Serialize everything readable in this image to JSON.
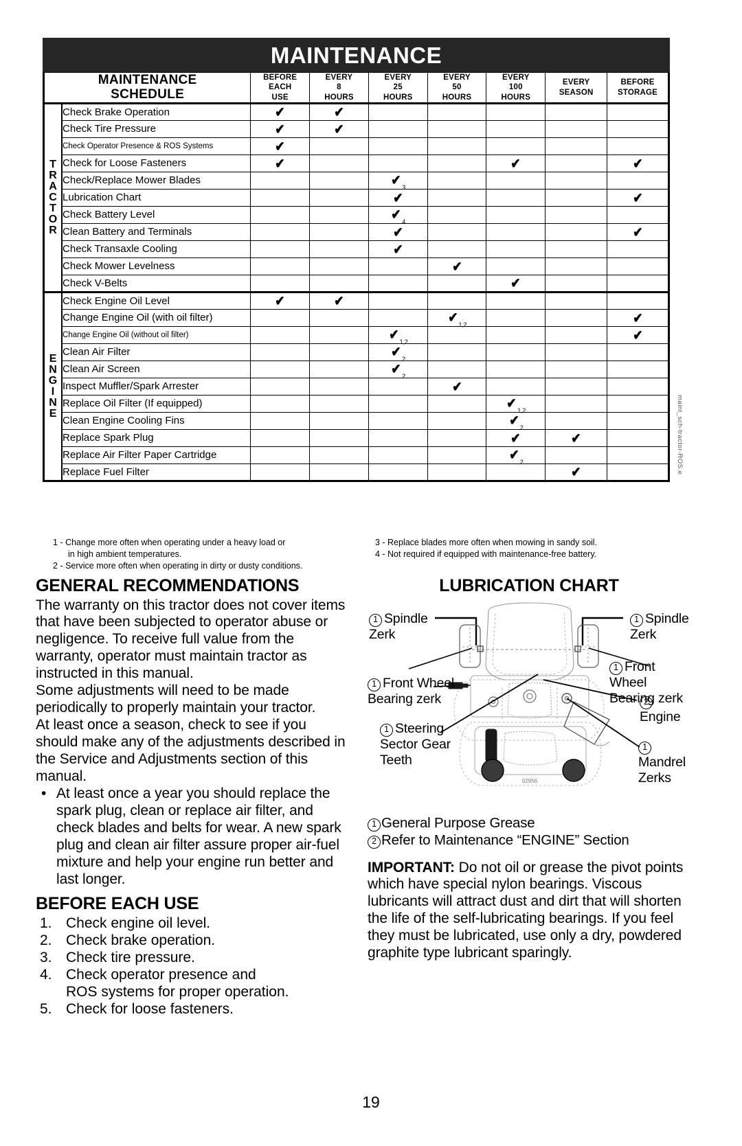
{
  "banner": {
    "title": "MAINTENANCE"
  },
  "schedule": {
    "title_line1": "MAINTENANCE",
    "title_line2": "SCHEDULE",
    "columns": [
      {
        "line1": "BEFORE",
        "line2": "EACH",
        "line3": "USE"
      },
      {
        "line1": "EVERY",
        "line2": "8",
        "line3": "HOURS"
      },
      {
        "line1": "EVERY",
        "line2": "25",
        "line3": "HOURS"
      },
      {
        "line1": "EVERY",
        "line2": "50",
        "line3": "HOURS"
      },
      {
        "line1": "EVERY",
        "line2": "100",
        "line3": "HOURS"
      },
      {
        "line1": "EVERY",
        "line2": "SEASON",
        "line3": ""
      },
      {
        "line1": "BEFORE",
        "line2": "STORAGE",
        "line3": ""
      }
    ],
    "groups": [
      {
        "name": "TRACTOR",
        "letters": [
          "T",
          "R",
          "A",
          "C",
          "T",
          "O",
          "R"
        ],
        "rows": [
          {
            "task": "Check Brake Operation",
            "small": false,
            "marks": [
              "x",
              "x",
              "",
              "",
              "",
              "",
              ""
            ]
          },
          {
            "task": "Check Tire Pressure",
            "small": false,
            "marks": [
              "x",
              "x",
              "",
              "",
              "",
              "",
              ""
            ]
          },
          {
            "task": "Check Operator Presence & ROS Systems",
            "small": true,
            "marks": [
              "x",
              "",
              "",
              "",
              "",
              "",
              ""
            ]
          },
          {
            "task": "Check for Loose Fasteners",
            "small": false,
            "marks": [
              "x",
              "",
              "",
              "",
              "x",
              "",
              "x"
            ]
          },
          {
            "task": "Check/Replace Mower Blades",
            "small": false,
            "marks": [
              "",
              "",
              "x:3",
              "",
              "",
              "",
              ""
            ]
          },
          {
            "task": "Lubrication Chart",
            "small": false,
            "marks": [
              "",
              "",
              "x",
              "",
              "",
              "",
              "x"
            ]
          },
          {
            "task": "Check Battery Level",
            "small": false,
            "marks": [
              "",
              "",
              "x:4",
              "",
              "",
              "",
              ""
            ]
          },
          {
            "task": "Clean Battery and Terminals",
            "small": false,
            "marks": [
              "",
              "",
              "x",
              "",
              "",
              "",
              "x"
            ]
          },
          {
            "task": "Check Transaxle Cooling",
            "small": false,
            "marks": [
              "",
              "",
              "x",
              "",
              "",
              "",
              ""
            ]
          },
          {
            "task": "Check Mower Levelness",
            "small": false,
            "marks": [
              "",
              "",
              "",
              "x",
              "",
              "",
              ""
            ]
          },
          {
            "task": "Check V-Belts",
            "small": false,
            "marks": [
              "",
              "",
              "",
              "",
              "x",
              "",
              ""
            ]
          }
        ]
      },
      {
        "name": "ENGINE",
        "letters": [
          "E",
          "N",
          "G",
          "I",
          "N",
          "E"
        ],
        "rows": [
          {
            "task": "Check Engine Oil Level",
            "small": false,
            "marks": [
              "x",
              "x",
              "",
              "",
              "",
              "",
              ""
            ]
          },
          {
            "task": "Change Engine Oil (with oil filter)",
            "small": false,
            "marks": [
              "",
              "",
              "",
              "x:1,2",
              "",
              "",
              "x"
            ]
          },
          {
            "task": "Change Engine Oil (without oil filter)",
            "small": true,
            "marks": [
              "",
              "",
              "x:1,2",
              "",
              "",
              "",
              "x"
            ]
          },
          {
            "task": "Clean Air Filter",
            "small": false,
            "marks": [
              "",
              "",
              "x:2",
              "",
              "",
              "",
              ""
            ]
          },
          {
            "task": "Clean Air Screen",
            "small": false,
            "marks": [
              "",
              "",
              "x:2",
              "",
              "",
              "",
              ""
            ]
          },
          {
            "task": "Inspect Muffler/Spark Arrester",
            "small": false,
            "marks": [
              "",
              "",
              "",
              "x",
              "",
              "",
              ""
            ]
          },
          {
            "task": "Replace Oil Filter (If equipped)",
            "small": false,
            "marks": [
              "",
              "",
              "",
              "",
              "x:1,2",
              "",
              ""
            ]
          },
          {
            "task": "Clean Engine Cooling Fins",
            "small": false,
            "marks": [
              "",
              "",
              "",
              "",
              "x:2",
              "",
              ""
            ]
          },
          {
            "task": "Replace Spark Plug",
            "small": false,
            "marks": [
              "",
              "",
              "",
              "",
              "x",
              "x",
              ""
            ]
          },
          {
            "task": "Replace Air Filter Paper Cartridge",
            "small": false,
            "marks": [
              "",
              "",
              "",
              "",
              "x:2",
              "",
              ""
            ]
          },
          {
            "task": "Replace Fuel Filter",
            "small": false,
            "marks": [
              "",
              "",
              "",
              "",
              "",
              "x",
              ""
            ]
          }
        ]
      }
    ],
    "footnotes_left": [
      {
        "num": "1 - ",
        "line1": "Change more often when operating under a heavy load or",
        "line2": "in high ambient temperatures."
      },
      {
        "num": "2 - ",
        "line1": "Service more often when operating in dirty or dusty conditions.",
        "line2": ""
      }
    ],
    "footnotes_right": [
      {
        "num": "3 - ",
        "line1": "Replace blades more often when mowing in sandy soil.",
        "line2": ""
      },
      {
        "num": "4 - ",
        "line1": "Not required if equipped with maintenance-free battery.",
        "line2": ""
      }
    ]
  },
  "general": {
    "heading": "GENERAL RECOMMENDATIONS",
    "para1": "The warranty on this tractor does not cover items that have been subjected to operator abuse or negligence.  To receive full value from the warranty, operator must maintain tractor as instructed in this manual.",
    "para2": "Some adjustments will need to be made periodically to properly maintain your tractor.",
    "para3": "At least once a season, check to see if you should make any of the adjustments described in the Service and Adjustments section of this manual.",
    "bullet_dot": "•",
    "bullet1": "At least once a year you should replace the spark plug, clean or replace air filter, and check blades and belts for wear. A new spark plug and clean air filter assure proper air-fuel mixture and help your engine run better and last longer."
  },
  "before_each_use": {
    "heading": "BEFORE EACH USE",
    "items": [
      {
        "num": "1.",
        "text": "Check engine oil level."
      },
      {
        "num": "2.",
        "text": "Check brake operation."
      },
      {
        "num": "3.",
        "text": "Check tire pressure."
      },
      {
        "num": "4.",
        "text": "Check operator presence and"
      },
      {
        "num": "5.",
        "text": "Check for loose fasteners."
      }
    ],
    "item4_cont": "ROS systems for proper operation."
  },
  "lubrication": {
    "heading": "LUBRICATION CHART",
    "labels": {
      "spindle_left_l1": "Spindle",
      "spindle_left_l2": "Zerk",
      "spindle_right_l1": "Spindle",
      "spindle_right_l2": "Zerk",
      "front_wheel_left_l1": "Front Wheel",
      "front_wheel_left_l2": "Bearing zerk",
      "front_wheel_right_l1": "Front Wheel",
      "front_wheel_right_l2": "Bearing zerk",
      "engine": "Engine",
      "steering_l1": "Steering",
      "steering_l2": "Sector Gear",
      "steering_l3": "Teeth",
      "mandrel_l1": "Mandrel",
      "mandrel_l2": "Zerks",
      "figure_code": "02956"
    },
    "marker_one": "1",
    "marker_two": "2",
    "key": [
      {
        "num": "1",
        "text": "General Purpose Grease"
      },
      {
        "num": "2",
        "text": "Refer to Maintenance “ENGINE” Section"
      }
    ],
    "important_label": "IMPORTANT:",
    "important_text": "  Do not oil or grease the pivot points which have special nylon bearings.  Viscous lubricants will attract dust and dirt that will shorten the life of the self-lubricating bearings.  If you feel they must be lubricated, use only a dry, powdered graphite type lubricant sparingly."
  },
  "side_code": "maint_sch-tractor-ROS.e",
  "page_number": "19",
  "check_glyph": "✔"
}
